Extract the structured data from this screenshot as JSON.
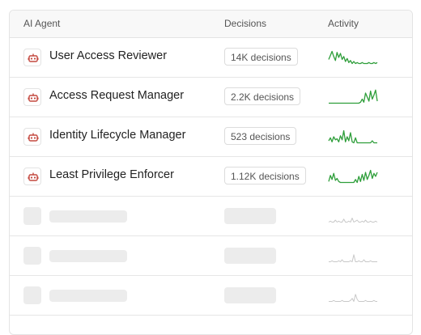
{
  "table": {
    "headers": {
      "agent": "AI Agent",
      "decisions": "Decisions",
      "activity": "Activity"
    },
    "rows": [
      {
        "name": "User Access Reviewer",
        "decisions": "14K decisions",
        "spark": [
          6,
          10,
          14,
          9,
          5,
          13,
          8,
          12,
          6,
          9,
          4,
          7,
          3,
          5,
          2,
          4,
          2,
          3,
          2,
          2,
          3,
          2,
          2,
          2,
          3,
          2,
          2,
          3,
          2,
          3
        ]
      },
      {
        "name": "Access Request Manager",
        "decisions": "2.2K decisions",
        "spark": [
          2,
          2,
          2,
          2,
          2,
          2,
          2,
          2,
          2,
          2,
          2,
          2,
          2,
          2,
          2,
          2,
          2,
          2,
          2,
          3,
          6,
          3,
          12,
          8,
          4,
          14,
          6,
          10,
          15,
          4
        ]
      },
      {
        "name": "Identity Lifecycle Manager",
        "decisions": "523 decisions",
        "spark": [
          4,
          7,
          3,
          8,
          5,
          6,
          3,
          9,
          5,
          14,
          3,
          8,
          4,
          12,
          3,
          2,
          7,
          2,
          2,
          2,
          2,
          2,
          2,
          2,
          2,
          2,
          4,
          2,
          2,
          2
        ]
      },
      {
        "name": "Least Privilege Enforcer",
        "decisions": "1.12K decisions",
        "spark": [
          3,
          9,
          5,
          11,
          4,
          6,
          3,
          2,
          2,
          2,
          2,
          2,
          2,
          2,
          2,
          2,
          5,
          2,
          8,
          3,
          10,
          4,
          12,
          5,
          9,
          14,
          6,
          11,
          8,
          12
        ]
      }
    ],
    "placeholders": [
      {
        "spark": [
          2,
          3,
          2,
          2,
          4,
          2,
          3,
          2,
          2,
          5,
          2,
          2,
          3,
          2,
          6,
          2,
          3,
          4,
          2,
          2,
          3,
          2,
          4,
          2,
          2,
          3,
          2,
          2,
          3,
          2
        ]
      },
      {
        "spark": [
          2,
          2,
          3,
          2,
          2,
          2,
          3,
          2,
          4,
          2,
          2,
          2,
          2,
          3,
          2,
          9,
          2,
          2,
          3,
          2,
          2,
          4,
          2,
          2,
          2,
          3,
          2,
          2,
          2,
          2
        ]
      },
      {
        "spark": [
          2,
          2,
          2,
          3,
          2,
          2,
          2,
          2,
          3,
          2,
          2,
          2,
          2,
          3,
          5,
          2,
          9,
          4,
          2,
          2,
          2,
          2,
          3,
          2,
          2,
          2,
          2,
          3,
          2,
          2
        ]
      }
    ]
  },
  "colors": {
    "accent_green": "#2e9e3a",
    "agent_icon_red": "#c4483f",
    "placeholder_line": "#c8c8c8"
  },
  "icons": {
    "agent": "robot-icon"
  }
}
